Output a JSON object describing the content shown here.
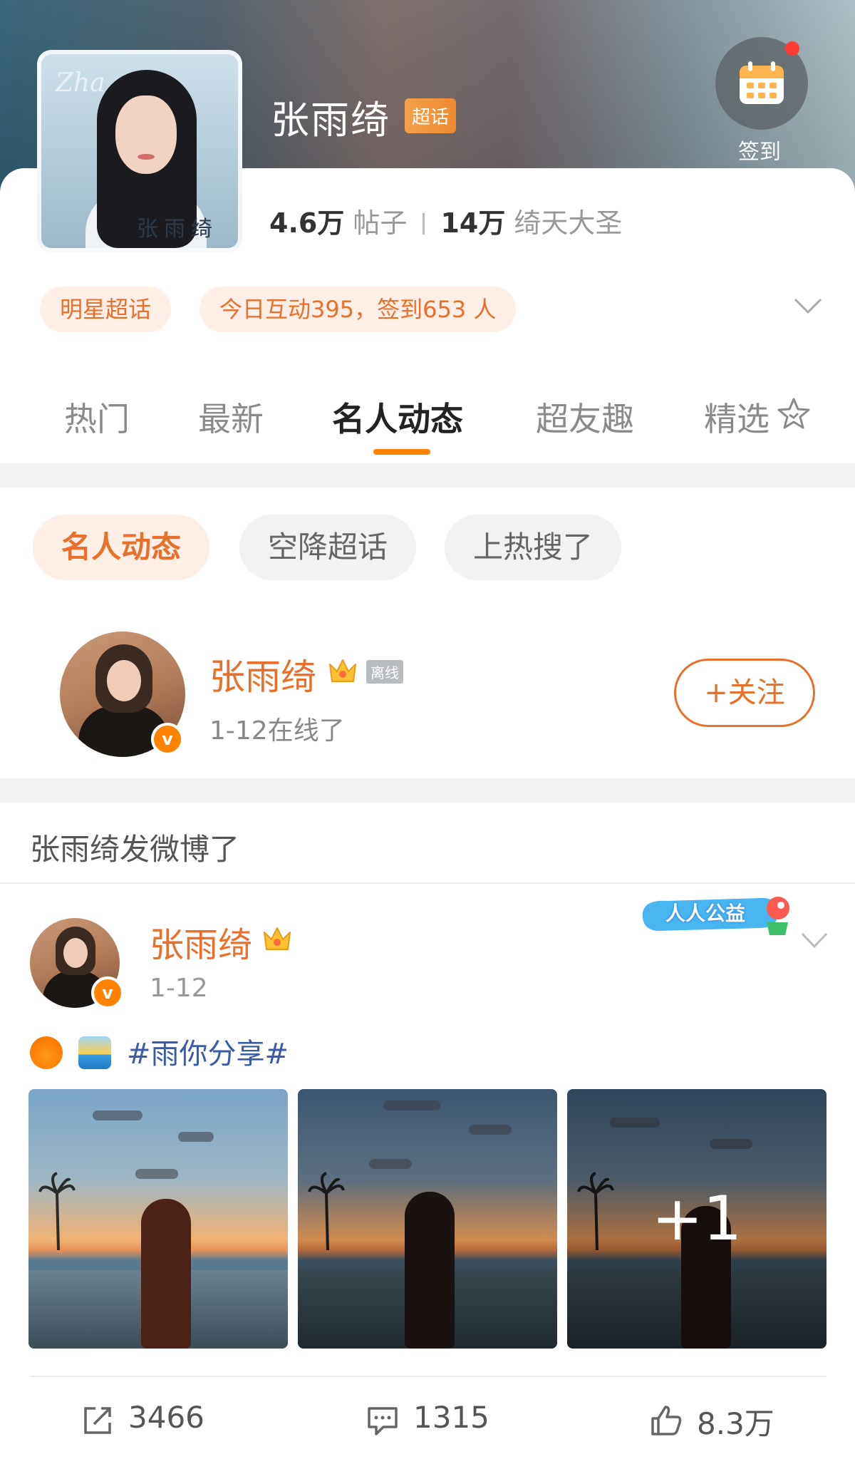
{
  "header": {
    "topic_title": "张雨绮",
    "topic_badge": "超话",
    "checkin_label": "签到",
    "posts_count": "4.6万",
    "posts_label": "帖子",
    "fans_count": "14万",
    "fans_label": "绮天大圣",
    "tag_category": "明星超话",
    "tag_today": "今日互动395，签到653 人"
  },
  "tabs": [
    "热门",
    "最新",
    "名人动态",
    "超友趣",
    "精选"
  ],
  "active_tab": "名人动态",
  "sub_chips": [
    "名人动态",
    "空降超话",
    "上热搜了"
  ],
  "celebrity": {
    "name": "张雨绮",
    "offline_tag": "离线",
    "status": "1-12在线了",
    "follow_label": "+关注",
    "verified_label": "v"
  },
  "feed": {
    "section_header": "张雨绮发微博了",
    "post": {
      "author": "张雨绮",
      "time": "1-12",
      "charity_label": "人人公益",
      "hashtag": "#雨你分享#",
      "more_photos": "+1",
      "reposts": "3466",
      "comments": "1315",
      "likes": "8.3万"
    }
  },
  "colors": {
    "accent": "#e8702a",
    "tab_underline": "#ff8200",
    "tag_bg": "#fdeee6",
    "hashtag": "#3b5ba8"
  },
  "icons": [
    "calendar-icon",
    "chevron-down-icon",
    "star-icon",
    "crown-icon",
    "verified-icon",
    "repost-icon",
    "comment-icon",
    "like-icon"
  ]
}
